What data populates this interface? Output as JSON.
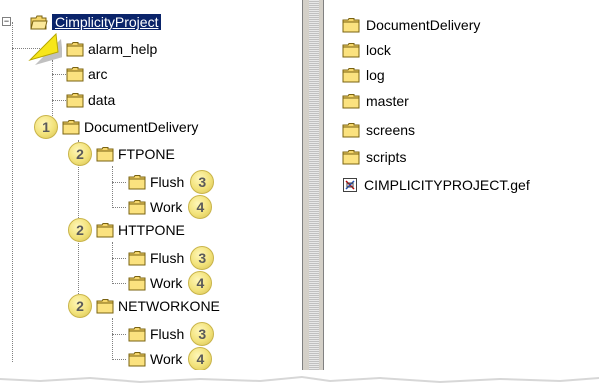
{
  "tree": {
    "root": {
      "label": "CimplicityProject"
    },
    "top_level": [
      {
        "label": "alarm_help"
      },
      {
        "label": "arc"
      },
      {
        "label": "data"
      }
    ],
    "document_delivery": {
      "label": "DocumentDelivery",
      "badge": "1"
    },
    "protocols": [
      {
        "label": "FTPONE",
        "badge": "2",
        "children": [
          {
            "label": "Flush",
            "badge": "3"
          },
          {
            "label": "Work",
            "badge": "4"
          }
        ]
      },
      {
        "label": "HTTPONE",
        "badge": "2",
        "children": [
          {
            "label": "Flush",
            "badge": "3"
          },
          {
            "label": "Work",
            "badge": "4"
          }
        ]
      },
      {
        "label": "NETWORKONE",
        "badge": "2",
        "children": [
          {
            "label": "Flush",
            "badge": "3"
          },
          {
            "label": "Work",
            "badge": "4"
          }
        ]
      }
    ]
  },
  "contents": {
    "items": [
      {
        "label": "DocumentDelivery",
        "icon": "folder-icon"
      },
      {
        "label": "lock",
        "icon": "folder-icon"
      },
      {
        "label": "log",
        "icon": "folder-icon"
      },
      {
        "label": "master",
        "icon": "folder-icon"
      },
      {
        "label": "screens",
        "icon": "folder-icon"
      },
      {
        "label": "scripts",
        "icon": "folder-icon"
      },
      {
        "label": "CIMPLICITYPROJECT.gef",
        "icon": "gef-file-icon"
      }
    ]
  },
  "colors": {
    "folder": "#f5d66a",
    "selection": "#0a246a",
    "badge": "#f2e27a",
    "pointer": "#f7e61a"
  }
}
